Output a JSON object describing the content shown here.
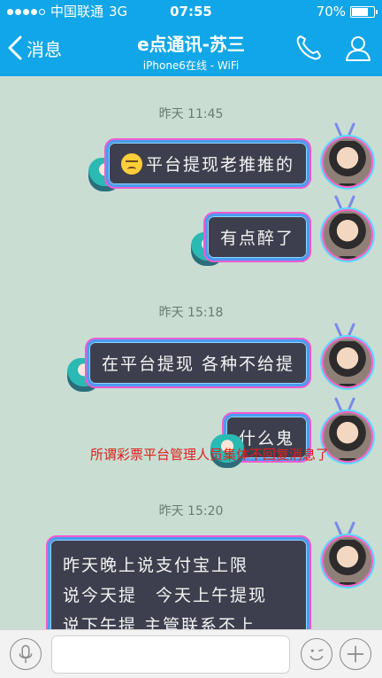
{
  "status_bar": {
    "carrier": "中国联通",
    "network": "3G",
    "time": "07:55",
    "battery": "70%"
  },
  "nav": {
    "back_label": "消息",
    "title": "e点通讯-苏三",
    "subtitle": "iPhone6在线 - WiFi",
    "icons": [
      "phone-icon",
      "profile-icon"
    ]
  },
  "messages": [
    {
      "type": "timestamp",
      "text": "昨天 11:45"
    },
    {
      "type": "sent",
      "emoji": "unamused-emoji",
      "lines": [
        "平台提现老推推的"
      ]
    },
    {
      "type": "sent",
      "lines": [
        "有点醉了"
      ]
    },
    {
      "type": "timestamp",
      "text": "昨天 15:18"
    },
    {
      "type": "sent",
      "lines": [
        "在平台提现 各种不给提"
      ]
    },
    {
      "type": "sent",
      "lines": [
        "什么鬼"
      ]
    },
    {
      "type": "timestamp",
      "text": "昨天 15:20"
    },
    {
      "type": "sent",
      "lines": [
        "昨天晚上说支付宝上限",
        "说今天提　今天上午提现",
        "说下午提 主管联系不上"
      ]
    }
  ],
  "overlay_text": "所谓彩票平台管理人员集体不回复消息了",
  "input_bar": {
    "placeholder": "",
    "icons": [
      "microphone-icon",
      "emoji-icon",
      "plus-icon"
    ]
  },
  "colors": {
    "nav_blue": "#11a6e7",
    "chat_bg": "#c9ddd3",
    "bubble_bg": "#3e3f4e",
    "overlay_red": "#e0201c"
  }
}
